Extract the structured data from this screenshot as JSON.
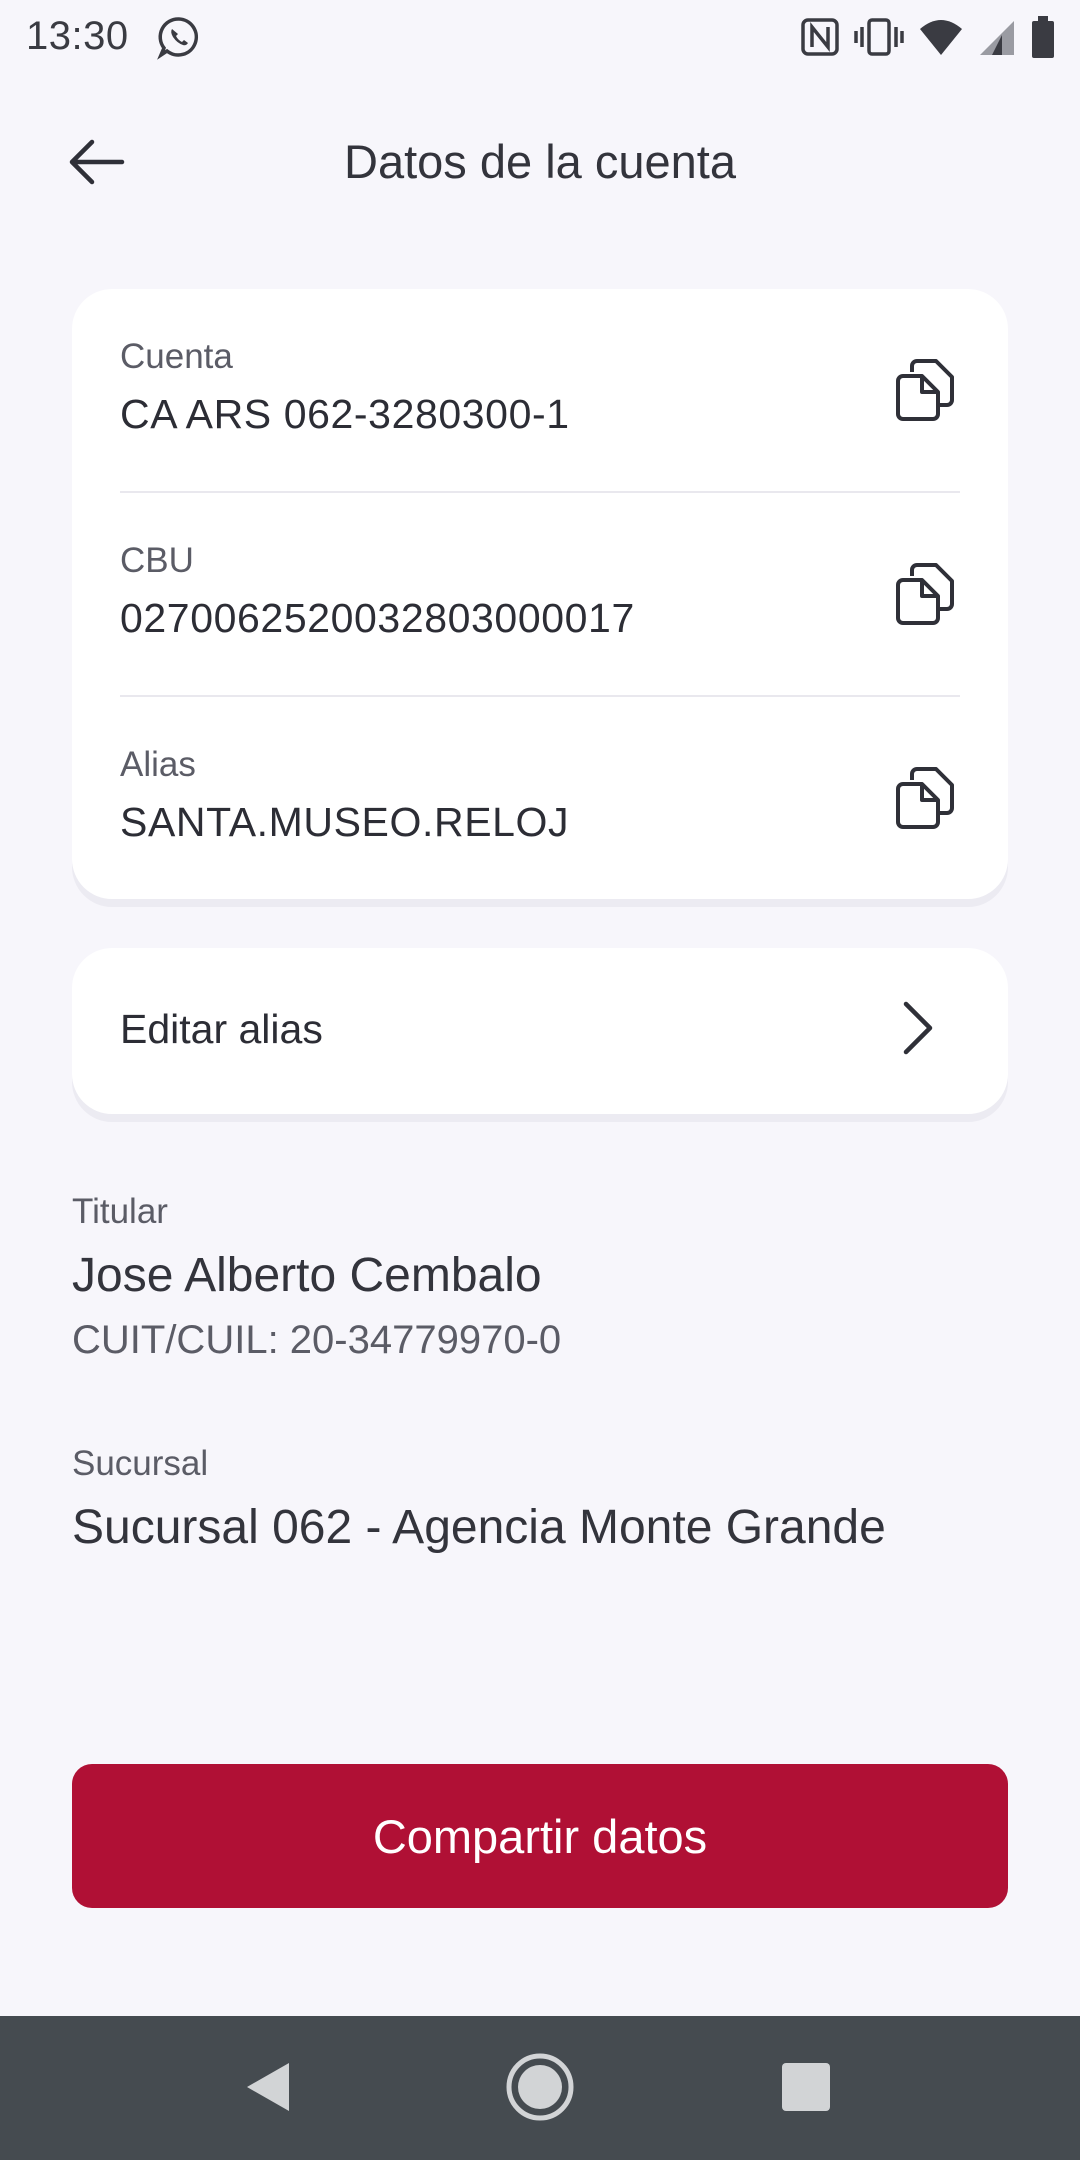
{
  "status_bar": {
    "time": "13:30",
    "icons": [
      "whatsapp-icon",
      "nfc-icon",
      "vibrate-icon",
      "wifi-icon",
      "signal-icon",
      "battery-icon"
    ]
  },
  "header": {
    "title": "Datos de la cuenta",
    "back_icon": "arrow-left-icon"
  },
  "account": {
    "rows": [
      {
        "label": "Cuenta",
        "value": "CA ARS 062-3280300-1",
        "action_icon": "copy-icon"
      },
      {
        "label": "CBU",
        "value": "0270062520032803000017",
        "action_icon": "copy-icon"
      },
      {
        "label": "Alias",
        "value": "SANTA.MUSEO.RELOJ",
        "action_icon": "copy-icon"
      }
    ]
  },
  "edit_alias": {
    "label": "Editar alias",
    "icon": "chevron-right-icon"
  },
  "holder": {
    "label": "Titular",
    "name": "Jose Alberto Cembalo",
    "tax_id": "CUIT/CUIL: 20-34779970-0"
  },
  "branch": {
    "label": "Sucursal",
    "value": "Sucursal 062 - Agencia Monte Grande"
  },
  "share_button": {
    "label": "Compartir datos"
  },
  "colors": {
    "primary": "#b01035",
    "background": "#f7f6fb",
    "nav_bar": "#454b50"
  },
  "nav_bar": {
    "icons": [
      "back-triangle-icon",
      "home-circle-icon",
      "recents-square-icon"
    ]
  }
}
